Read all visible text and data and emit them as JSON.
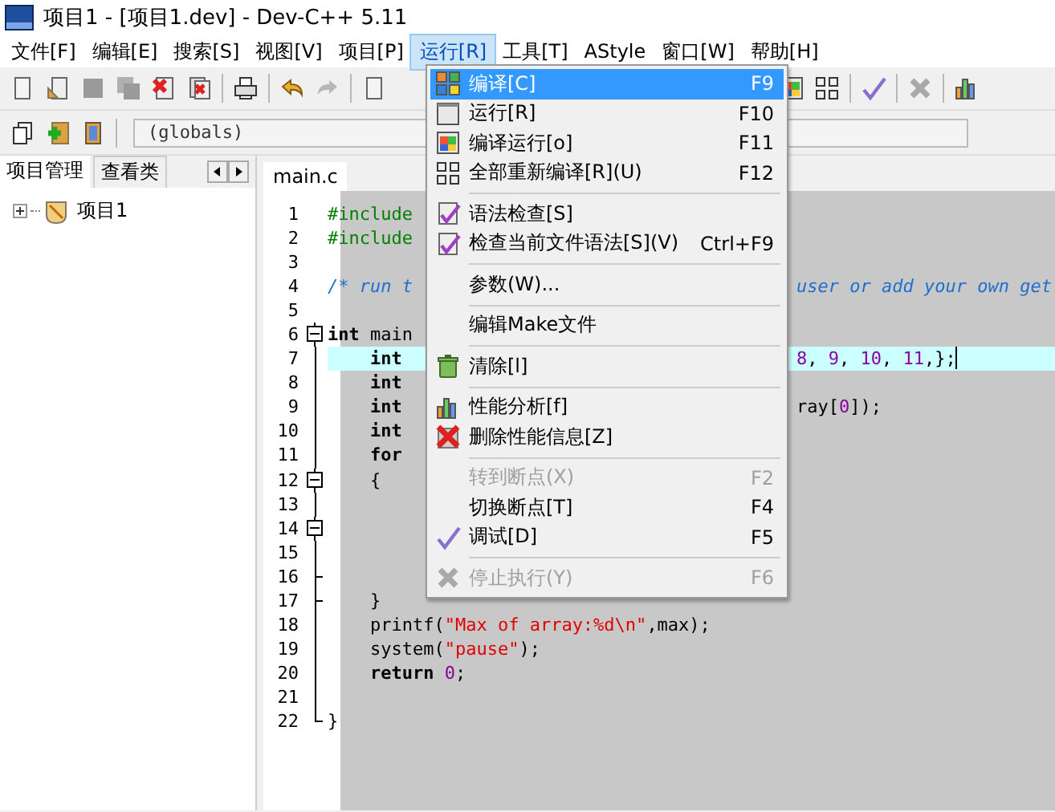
{
  "window": {
    "title": "项目1 - [项目1.dev] - Dev-C++ 5.11"
  },
  "menubar": [
    {
      "label": "文件[F]",
      "selected": false
    },
    {
      "label": "编辑[E]",
      "selected": false
    },
    {
      "label": "搜索[S]",
      "selected": false
    },
    {
      "label": "视图[V]",
      "selected": false
    },
    {
      "label": "项目[P]",
      "selected": false
    },
    {
      "label": "运行[R]",
      "selected": true
    },
    {
      "label": "工具[T]",
      "selected": false
    },
    {
      "label": "AStyle",
      "selected": false
    },
    {
      "label": "窗口[W]",
      "selected": false
    },
    {
      "label": "帮助[H]",
      "selected": false
    }
  ],
  "scope_selector": {
    "value": "(globals)"
  },
  "left_panel": {
    "tabs": [
      {
        "label": "项目管理",
        "selected": true
      },
      {
        "label": "查看类",
        "selected": false
      }
    ],
    "tree": [
      {
        "label": "项目1",
        "expanded": false
      }
    ]
  },
  "editor": {
    "tabs": [
      {
        "label": "main.c",
        "selected": true
      }
    ],
    "lines": [
      {
        "number": "1",
        "kind": "plain",
        "current": false,
        "left": [
          {
            "kind": "pre",
            "text": "#include"
          }
        ]
      },
      {
        "number": "2",
        "kind": "plain",
        "current": false,
        "left": [
          {
            "kind": "pre",
            "text": "#include"
          }
        ]
      },
      {
        "number": "3",
        "kind": "plain",
        "current": false
      },
      {
        "number": "4",
        "kind": "plain",
        "current": false,
        "left": [
          {
            "kind": "comment",
            "text": "/* run t"
          }
        ],
        "right": [
          {
            "kind": "comment",
            "text": "user or add your own get"
          }
        ]
      },
      {
        "number": "5",
        "kind": "plain",
        "current": false
      },
      {
        "number": "6",
        "kind": "fold_start",
        "current": false,
        "left": [
          {
            "kind": "kw",
            "text": "int"
          },
          {
            "kind": "plain",
            "text": " main"
          }
        ]
      },
      {
        "number": "7",
        "kind": "fold_line",
        "current": true,
        "left": [
          {
            "kind": "kw",
            "text": "int"
          }
        ],
        "right": [
          {
            "kind": "num",
            "text": "8"
          },
          {
            "kind": "plain",
            "text": ", "
          },
          {
            "kind": "num",
            "text": "9"
          },
          {
            "kind": "plain",
            "text": ", "
          },
          {
            "kind": "num",
            "text": "10"
          },
          {
            "kind": "plain",
            "text": ", "
          },
          {
            "kind": "num",
            "text": "11"
          },
          {
            "kind": "plain",
            "text": ",};"
          }
        ]
      },
      {
        "number": "8",
        "kind": "fold_line",
        "current": false,
        "left": [
          {
            "kind": "kw",
            "text": "int"
          }
        ]
      },
      {
        "number": "9",
        "kind": "fold_line",
        "current": false,
        "left": [
          {
            "kind": "kw",
            "text": "int"
          }
        ],
        "right": [
          {
            "kind": "plain",
            "text": "ray["
          },
          {
            "kind": "num",
            "text": "0"
          },
          {
            "kind": "plain",
            "text": "]);"
          }
        ]
      },
      {
        "number": "10",
        "kind": "fold_line",
        "current": false,
        "left": [
          {
            "kind": "kw",
            "text": "int"
          }
        ]
      },
      {
        "number": "11",
        "kind": "fold_line",
        "current": false,
        "left": [
          {
            "kind": "kw",
            "text": "for"
          }
        ]
      },
      {
        "number": "12",
        "kind": "fold_start",
        "current": false,
        "left": [
          {
            "kind": "plain",
            "text": "{"
          }
        ]
      },
      {
        "number": "13",
        "kind": "fold_line",
        "current": false
      },
      {
        "number": "14",
        "kind": "fold_start",
        "current": false
      },
      {
        "number": "15",
        "kind": "fold_line",
        "current": false
      },
      {
        "number": "16",
        "kind": "fold_tick",
        "current": false
      },
      {
        "number": "17",
        "kind": "fold_tick",
        "current": false,
        "left": [
          {
            "kind": "plain",
            "text": "}"
          }
        ]
      },
      {
        "number": "18",
        "kind": "fold_line",
        "current": false,
        "left": [
          {
            "kind": "plain",
            "text": "printf("
          },
          {
            "kind": "str",
            "text": "\"Max of array:%d\\n\""
          },
          {
            "kind": "plain",
            "text": ",max);"
          }
        ]
      },
      {
        "number": "19",
        "kind": "fold_line",
        "current": false,
        "left": [
          {
            "kind": "plain",
            "text": "system("
          },
          {
            "kind": "str",
            "text": "\"pause\""
          },
          {
            "kind": "plain",
            "text": ");"
          }
        ]
      },
      {
        "number": "20",
        "kind": "fold_line",
        "current": false,
        "left": [
          {
            "kind": "kw",
            "text": "return "
          },
          {
            "kind": "num",
            "text": "0"
          },
          {
            "kind": "plain",
            "text": ";"
          }
        ]
      },
      {
        "number": "21",
        "kind": "fold_line",
        "current": false
      },
      {
        "number": "22",
        "kind": "fold_end",
        "current": false,
        "left": [
          {
            "kind": "plain",
            "text": "}"
          }
        ]
      }
    ]
  },
  "run_menu": [
    {
      "kind": "item",
      "label": "编译[C]",
      "shortcut": "F9",
      "disabled": false,
      "selected": true
    },
    {
      "kind": "item",
      "label": "运行[R]",
      "shortcut": "F10",
      "disabled": false,
      "selected": false
    },
    {
      "kind": "item",
      "label": "编译运行[o]",
      "shortcut": "F11",
      "disabled": false,
      "selected": false
    },
    {
      "kind": "item",
      "label": "全部重新编译[R](U)",
      "shortcut": "F12",
      "disabled": false,
      "selected": false
    },
    {
      "kind": "separator"
    },
    {
      "kind": "item",
      "label": "语法检查[S]",
      "disabled": false,
      "selected": false
    },
    {
      "kind": "item",
      "label": "检查当前文件语法[S](V)",
      "shortcut": "Ctrl+F9",
      "disabled": false,
      "selected": false
    },
    {
      "kind": "separator"
    },
    {
      "kind": "item",
      "label": "参数(W)...",
      "disabled": false,
      "selected": false
    },
    {
      "kind": "separator"
    },
    {
      "kind": "item",
      "label": "编辑Make文件",
      "disabled": false,
      "selected": false
    },
    {
      "kind": "separator"
    },
    {
      "kind": "item",
      "label": "清除[l]",
      "disabled": false,
      "selected": false
    },
    {
      "kind": "separator"
    },
    {
      "kind": "item",
      "label": "性能分析[f]",
      "disabled": false,
      "selected": false
    },
    {
      "kind": "item",
      "label": "删除性能信息[Z]",
      "disabled": false,
      "selected": false
    },
    {
      "kind": "separator"
    },
    {
      "kind": "item",
      "label": "转到断点(X)",
      "shortcut": "F2",
      "disabled": true,
      "selected": false
    },
    {
      "kind": "item",
      "label": "切换断点[T]",
      "shortcut": "F4",
      "disabled": false,
      "selected": false
    },
    {
      "kind": "item",
      "label": "调试[D]",
      "shortcut": "F5",
      "disabled": false,
      "selected": false
    },
    {
      "kind": "separator"
    },
    {
      "kind": "item",
      "label": "停止执行(Y)",
      "shortcut": "F6",
      "disabled": true,
      "selected": false
    }
  ]
}
